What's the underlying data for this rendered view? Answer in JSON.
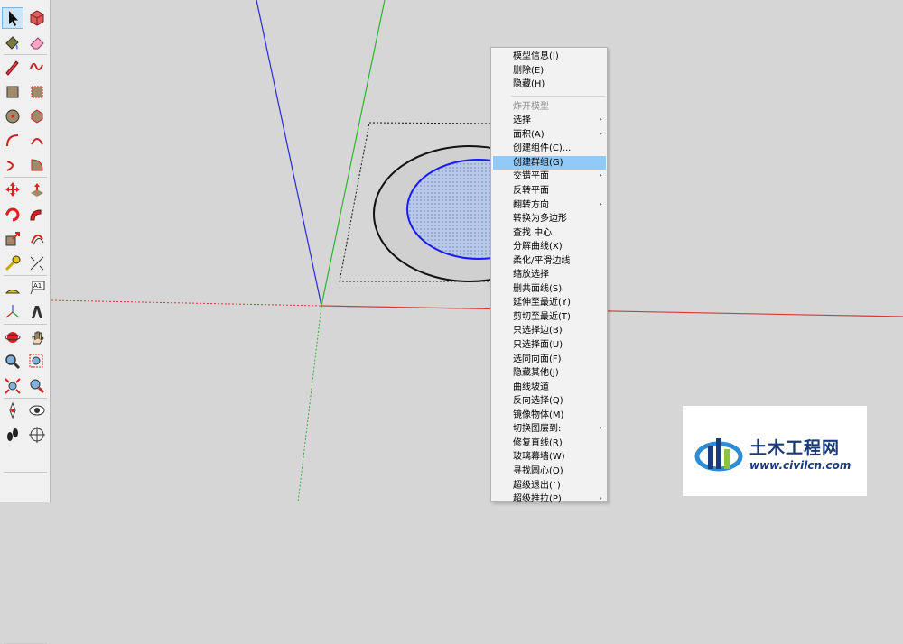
{
  "toolbar": {
    "tools": [
      {
        "icon": "select-arrow-icon",
        "active": true
      },
      {
        "icon": "make-component-icon"
      },
      {
        "icon": "paint-bucket-icon"
      },
      {
        "icon": "eraser-icon"
      },
      {
        "icon": "pencil-line-icon"
      },
      {
        "icon": "freehand-icon"
      },
      {
        "icon": "rectangle-icon"
      },
      {
        "icon": "rotated-rectangle-icon"
      },
      {
        "icon": "circle-icon"
      },
      {
        "icon": "polygon-icon"
      },
      {
        "icon": "arc-icon"
      },
      {
        "icon": "two-point-arc-icon"
      },
      {
        "icon": "three-point-arc-icon"
      },
      {
        "icon": "pie-icon"
      },
      {
        "icon": "move-icon"
      },
      {
        "icon": "push-pull-icon"
      },
      {
        "icon": "rotate-icon"
      },
      {
        "icon": "follow-me-icon"
      },
      {
        "icon": "scale-icon"
      },
      {
        "icon": "offset-icon"
      },
      {
        "icon": "tape-measure-icon"
      },
      {
        "icon": "dimension-icon"
      },
      {
        "icon": "protractor-icon"
      },
      {
        "icon": "text-tool-icon",
        "label": "A1"
      },
      {
        "icon": "axes-icon"
      },
      {
        "icon": "3d-text-icon"
      },
      {
        "icon": "orbit-icon"
      },
      {
        "icon": "pan-hand-icon"
      },
      {
        "icon": "zoom-icon"
      },
      {
        "icon": "zoom-window-icon"
      },
      {
        "icon": "zoom-extents-icon"
      },
      {
        "icon": "previous-view-icon"
      },
      {
        "icon": "position-camera-icon"
      },
      {
        "icon": "look-around-icon"
      },
      {
        "icon": "walk-icon"
      },
      {
        "icon": "section-plane-icon"
      }
    ]
  },
  "scene": {
    "axis_colors": {
      "blue": "#2a2ad4",
      "green": "#2bb52b",
      "red": "#d43a3a"
    },
    "fill_color": "#b7c8ea",
    "circle_outline": "#1a1aff"
  },
  "context_menu": {
    "items": [
      {
        "label": "模型信息(I)"
      },
      {
        "label": "删除(E)"
      },
      {
        "label": "隐藏(H)"
      },
      {
        "separator": true
      },
      {
        "label": "炸开模型",
        "disabled": true
      },
      {
        "label": "选择",
        "submenu": true
      },
      {
        "label": "面积(A)",
        "submenu": true
      },
      {
        "label": "创建组件(C)..."
      },
      {
        "label": "创建群组(G)",
        "highlighted": true
      },
      {
        "label": "交错平面",
        "submenu": true
      },
      {
        "label": "反转平面"
      },
      {
        "label": "翻转方向",
        "submenu": true
      },
      {
        "label": "转换为多边形"
      },
      {
        "label": "查找 中心"
      },
      {
        "label": "分解曲线(X)"
      },
      {
        "label": "柔化/平滑边线"
      },
      {
        "label": "缩放选择"
      },
      {
        "label": "删共面线(S)"
      },
      {
        "label": "延伸至最近(Y)"
      },
      {
        "label": "剪切至最近(T)"
      },
      {
        "label": "只选择边(B)"
      },
      {
        "label": "只选择面(U)"
      },
      {
        "label": "选同向面(F)"
      },
      {
        "label": "隐藏其他(J)"
      },
      {
        "label": "曲线坡道"
      },
      {
        "label": "反向选择(Q)"
      },
      {
        "label": "镜像物体(M)"
      },
      {
        "label": "切换图层到:",
        "submenu": true
      },
      {
        "label": "修复直线(R)"
      },
      {
        "label": "玻璃幕墙(W)"
      },
      {
        "label": "寻找圆心(O)"
      },
      {
        "label": "超级退出(`)"
      },
      {
        "label": "超级推拉(P)",
        "submenu": true
      }
    ]
  },
  "watermark": {
    "title": "土木工程网",
    "url": "www.civilcn.com"
  }
}
